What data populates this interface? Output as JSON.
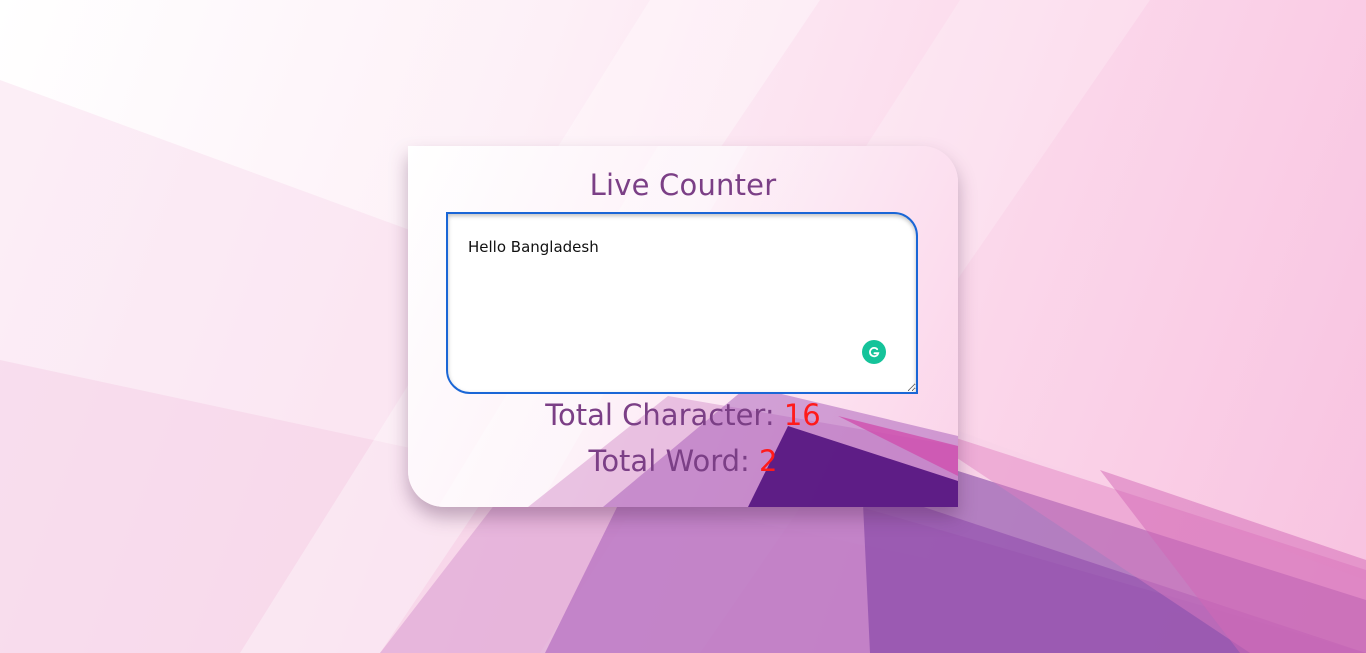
{
  "counter": {
    "title": "Live Counter",
    "text_value": "Hello Bangladesh",
    "char_label": "Total Character: ",
    "char_count": "16",
    "word_label": "Total Word: ",
    "word_count": "2"
  },
  "icons": {
    "grammarly": "grammarly-icon"
  },
  "colors": {
    "title": "#7b3f86",
    "count": "#ff1a1a",
    "textarea_border": "#1a66d6",
    "grammarly": "#15c39a",
    "accent_purple": "#4b0a7a"
  }
}
